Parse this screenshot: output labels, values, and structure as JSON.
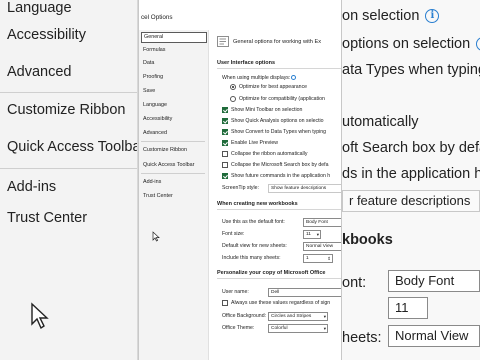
{
  "background_left": {
    "items": [
      {
        "label": "Language"
      },
      {
        "label": "Accessibility"
      },
      {
        "label": "Advanced"
      },
      {
        "label": "Customize Ribbon"
      },
      {
        "label": "Quick Access Toolbar"
      },
      {
        "label": "Add-ins"
      },
      {
        "label": "Trust Center"
      }
    ]
  },
  "background_right": {
    "lines": [
      {
        "text": "on selection",
        "info": "i"
      },
      {
        "text": "options on selection",
        "info": "i"
      },
      {
        "text": "ata Types when typing",
        "info": "i"
      },
      {
        "text": "utomatically"
      },
      {
        "text": "oft Search box by default"
      },
      {
        "text": "ds in the application h"
      },
      {
        "text": "r feature descriptions"
      },
      {
        "text": "kbooks"
      },
      {
        "text": "ont:"
      },
      {
        "text": "heets:"
      }
    ],
    "boxes": {
      "font": "Body Font",
      "size": "11",
      "view": "Normal View"
    }
  },
  "dialog": {
    "title": "cel Options",
    "nav": [
      {
        "label": "General",
        "active": true
      },
      {
        "label": "Formulas"
      },
      {
        "label": "Data"
      },
      {
        "label": "Proofing"
      },
      {
        "label": "Save"
      },
      {
        "label": "Language"
      },
      {
        "label": "Accessibility"
      },
      {
        "label": "Advanced"
      },
      {
        "label": "Customize Ribbon"
      },
      {
        "label": "Quick Access Toolbar"
      },
      {
        "label": "Add-ins"
      },
      {
        "label": "Trust Center"
      }
    ],
    "intro": "General options for working with Ex",
    "ui_section": {
      "heading": "User Interface options",
      "multi_display_label": "When using multiple displays:",
      "radio_best": "Optimize for best appearance",
      "radio_compat": "Optimize for compatibility (application",
      "checks": [
        {
          "label": "Show Mini Toolbar on selection",
          "checked": true
        },
        {
          "label": "Show Quick Analysis options on selectio",
          "checked": true
        },
        {
          "label": "Show Convert to Data Types when typing",
          "checked": true
        },
        {
          "label": "Enable Live Preview",
          "checked": true
        },
        {
          "label": "Collapse the ribbon automatically",
          "checked": false
        },
        {
          "label": "Collapse the Microsoft Search box by defa",
          "checked": false
        },
        {
          "label": "Show future commands in the application h",
          "checked": true
        }
      ],
      "screentip_label": "ScreenTip style:",
      "screentip_value": "Show feature descriptions"
    },
    "workbook_section": {
      "heading": "When creating new workbooks",
      "font_label": "Use this as the default font:",
      "font_value": "Body Font",
      "size_label": "Font size:",
      "size_value": "11",
      "view_label": "Default view for new sheets:",
      "view_value": "Normal View",
      "sheets_label": "Include this many sheets:",
      "sheets_value": "1"
    },
    "personalize_section": {
      "heading": "Personalize your copy of Microsoft Office",
      "username_label": "User name:",
      "username_value": "Dell",
      "always_use_label": "Always use these values regardless of sign",
      "background_label": "Office Background:",
      "background_value": "Circles and Stripes",
      "theme_label": "Office Theme:",
      "theme_value": "Colorful"
    }
  }
}
